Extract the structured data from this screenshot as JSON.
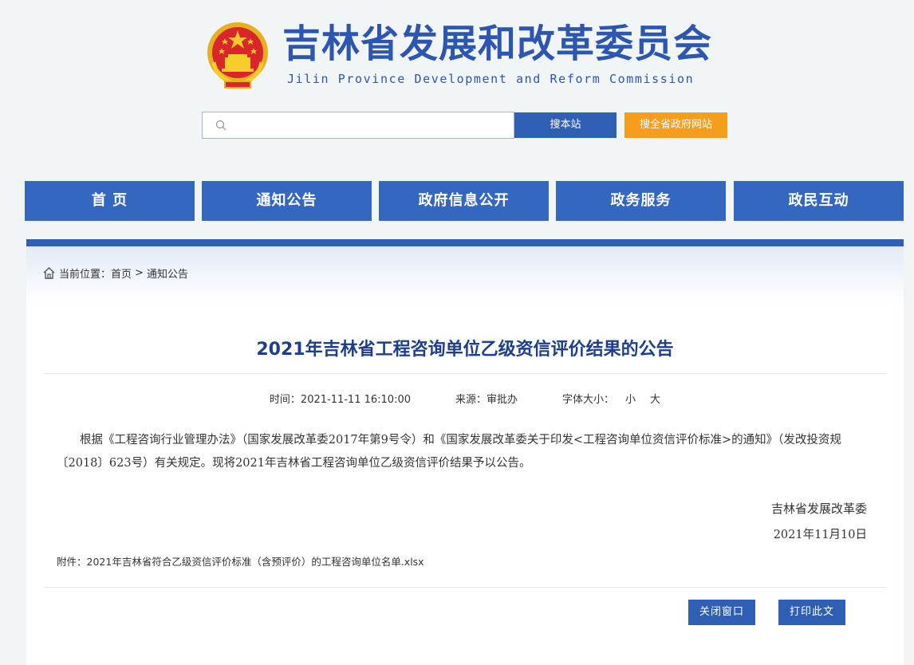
{
  "header": {
    "site_title": "吉林省发展和改革委员会",
    "site_subtitle": "Jilin Province Development and Reform Commission",
    "emblem_icon": "national-emblem-icon"
  },
  "search": {
    "placeholder": "",
    "value": "",
    "search_site_label": "搜本站",
    "search_gov_label": "搜全省政府网站"
  },
  "nav": {
    "items": [
      {
        "label": "首 页"
      },
      {
        "label": "通知公告"
      },
      {
        "label": "政府信息公开"
      },
      {
        "label": "政务服务"
      },
      {
        "label": "政民互动"
      }
    ]
  },
  "breadcrumb": {
    "prefix": "当前位置：",
    "home": "首页",
    "separator": ">",
    "current": "通知公告"
  },
  "article": {
    "title": "2021年吉林省工程咨询单位乙级资信评价结果的公告",
    "time_label": "时间：2021-11-11 16:10:00",
    "source_label": "来源：审批办",
    "font_size_label": "字体大小：",
    "font_small": "小",
    "font_large": "大",
    "body": "根据《工程咨询行业管理办法》（国家发展改革委2017年第9号令）和《国家发展改革委关于印发<工程咨询单位资信评价标准>的通知》（发改投资规〔2018〕623号）有关规定。现将2021年吉林省工程咨询单位乙级资信评价结果予以公告。",
    "sign_org": "吉林省发展改革委",
    "sign_date": "2021年11月10日",
    "attachment_prefix": "附件：",
    "attachment_name": "2021年吉林省符合乙级资信评价标准（含预评价）的工程咨询单位名单.xlsx"
  },
  "actions": {
    "close_label": "关闭窗口",
    "print_label": "打印此文"
  },
  "colors": {
    "primary": "#3467c0",
    "title_blue": "#2c56b0",
    "orange": "#f79d1c",
    "article_title": "#1d3f8a"
  }
}
